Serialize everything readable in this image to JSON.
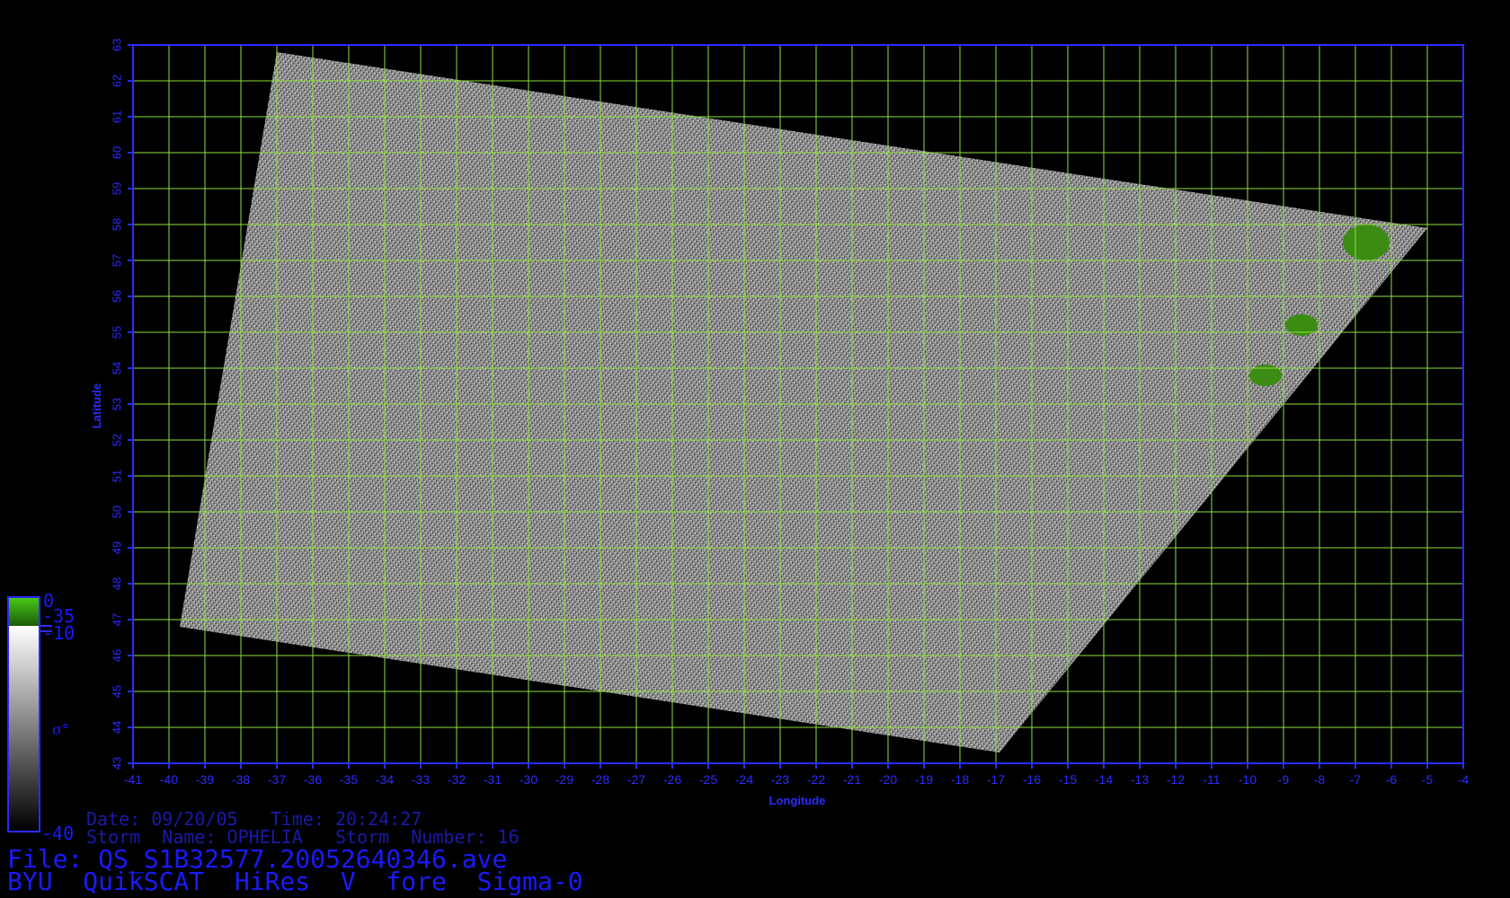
{
  "map": {
    "lon_ticks": [
      "-41",
      "-40",
      "-39",
      "-38",
      "-37",
      "-36",
      "-35",
      "-34",
      "-33",
      "-32",
      "-31",
      "-30",
      "-29",
      "-28",
      "-27",
      "-26",
      "-25",
      "-24",
      "-23",
      "-22",
      "-21",
      "-20",
      "-19",
      "-18",
      "-17",
      "-16",
      "-15",
      "-14",
      "-13",
      "-12",
      "-11",
      "-10",
      "-9",
      "-8",
      "-7",
      "-6",
      "-5",
      "-4"
    ],
    "lat_ticks": [
      "43",
      "44",
      "45",
      "46",
      "47",
      "48",
      "49",
      "50",
      "51",
      "52",
      "53",
      "54",
      "55",
      "56",
      "57",
      "58",
      "59",
      "60",
      "61",
      "62",
      "63"
    ],
    "lon_range": [
      -41,
      -4
    ],
    "lat_range": [
      43,
      63
    ],
    "xlabel": "Longitude",
    "ylabel": "Latitude",
    "swath_corners": [
      {
        "lon": -37.0,
        "lat": 62.8
      },
      {
        "lon": -5.0,
        "lat": 57.9
      },
      {
        "lon": -16.9,
        "lat": 43.3
      },
      {
        "lon": -39.7,
        "lat": 46.8
      }
    ],
    "land_patches": [
      {
        "lon": -6.7,
        "lat": 57.5
      },
      {
        "lon": -8.5,
        "lat": 55.2
      },
      {
        "lon": -9.5,
        "lat": 53.8
      }
    ]
  },
  "colorbar": {
    "tick_top": "0",
    "tick_green_bottom": "-35",
    "tick_white_top": "-10",
    "tick_bottom": "-40",
    "symbol": "σ°"
  },
  "info": {
    "date_line": "Date: 09/20/05   Time: 20:24:27",
    "storm_line": "Storm  Name: OPHELIA   Storm  Number: 16",
    "file_line": "File: QS_S1B32577.20052640346.ave",
    "product_line": "BYU  QuikSCAT  HiRes  V  fore  Sigma-0"
  },
  "colors": {
    "background": "#000000",
    "axis": "#2b2bff",
    "grid": "#8ce03c",
    "land": "#3c8c14",
    "info_text": "#1a1aa8",
    "file_text": "#1a1aff"
  }
}
